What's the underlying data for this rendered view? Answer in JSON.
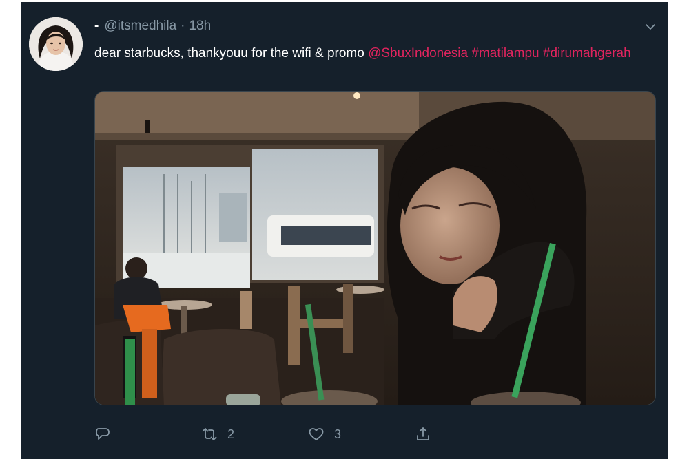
{
  "tweet": {
    "display_name": "-",
    "handle": "@itsmedhila",
    "separator": "·",
    "time": "18h",
    "text_plain": "dear starbucks, thankyouu for the wifi & promo ",
    "mention": "@SbuxIndonesia",
    "hashtag_1": "#matilampu",
    "hashtag_2": "#dirumahgerah",
    "media_icon": "photo",
    "colors": {
      "background": "#15202b",
      "link": "#e0245e",
      "muted": "#8899a6"
    }
  },
  "actions": {
    "reply": {
      "icon": "reply-icon",
      "count": ""
    },
    "retweet": {
      "icon": "retweet-icon",
      "count": "2"
    },
    "like": {
      "icon": "heart-icon",
      "count": "3"
    },
    "share": {
      "icon": "share-icon",
      "count": ""
    }
  }
}
